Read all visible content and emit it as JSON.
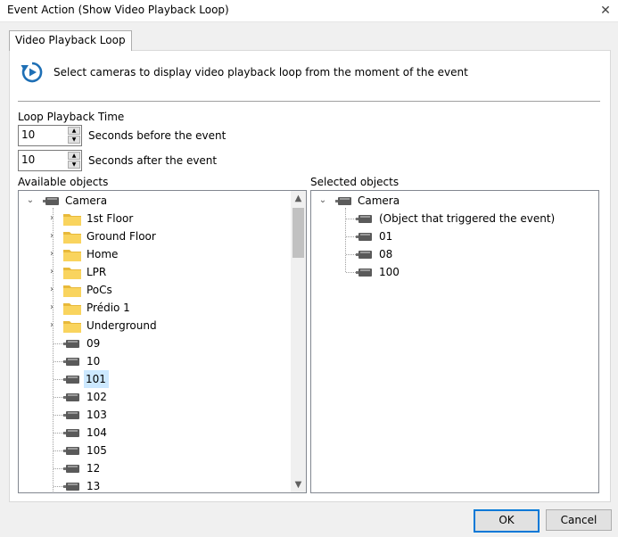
{
  "window": {
    "title": "Event Action (Show Video Playback Loop)",
    "close_glyph": "✕"
  },
  "tab": {
    "label": "Video Playback Loop"
  },
  "description": "Select cameras to display video playback loop from the moment of the event",
  "loop": {
    "heading": "Loop Playback Time",
    "before_value": "10",
    "before_label": "Seconds before the event",
    "after_value": "10",
    "after_label": "Seconds after the event"
  },
  "available": {
    "heading": "Available objects",
    "root": "Camera",
    "folders": [
      "1st Floor",
      "Ground Floor",
      "Home",
      "LPR",
      "PoCs",
      "Prédio 1",
      "Underground"
    ],
    "cameras": [
      "09",
      "10",
      "101",
      "102",
      "103",
      "104",
      "105",
      "12",
      "13"
    ],
    "selected_item": "101"
  },
  "selected": {
    "heading": "Selected objects",
    "root": "Camera",
    "items": [
      "(Object that triggered the event)",
      "01",
      "08",
      "100"
    ]
  },
  "buttons": {
    "ok": "OK",
    "cancel": "Cancel"
  },
  "colors": {
    "accent": "#0078d7",
    "selection": "#cce8ff",
    "folder": "#f9d45e",
    "icon": "#1e6fb5"
  }
}
